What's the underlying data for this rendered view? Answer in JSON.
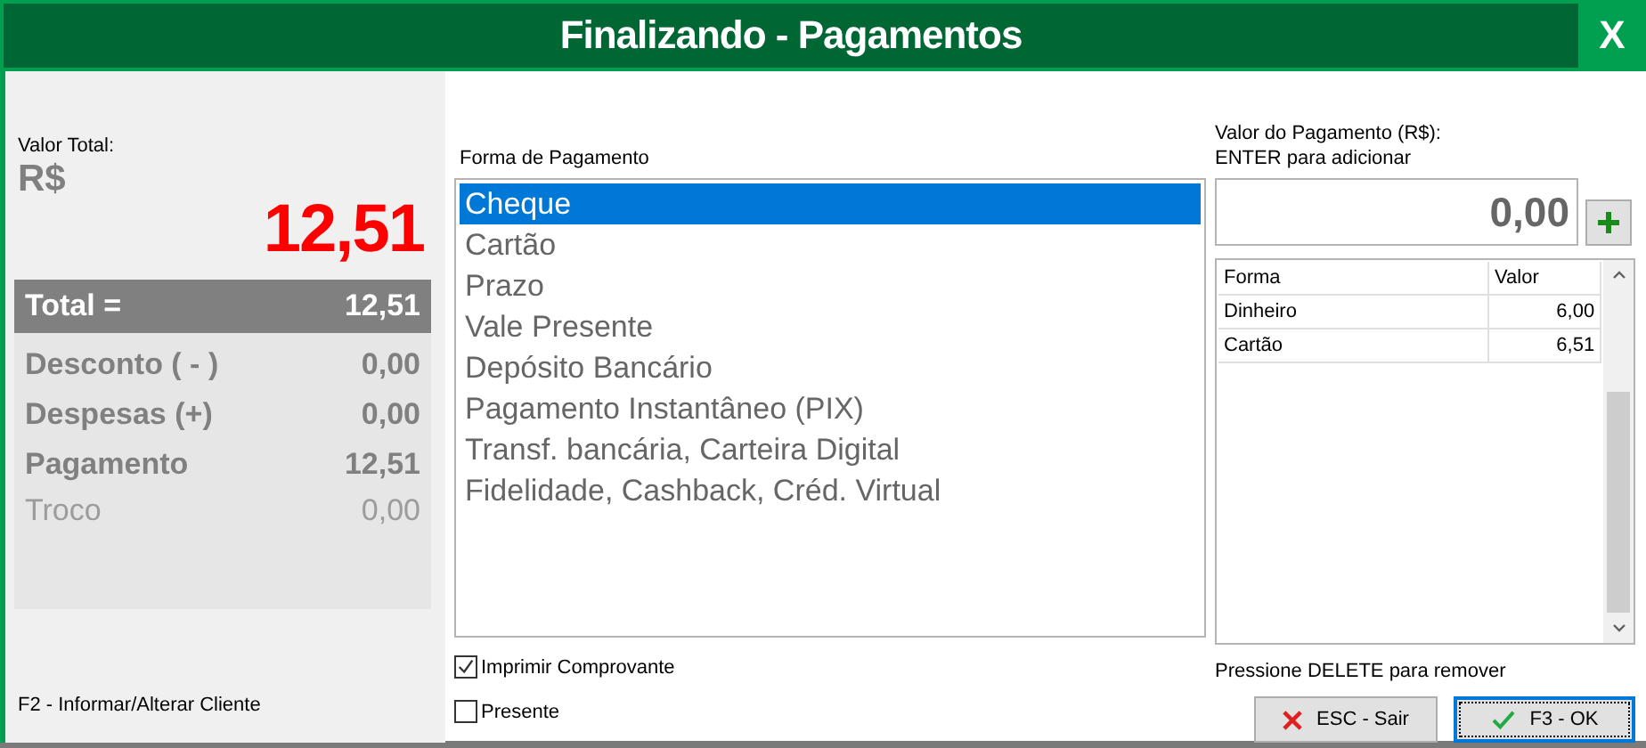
{
  "window": {
    "title": "Finalizando - Pagamentos",
    "close": "X"
  },
  "summary": {
    "label": "Valor Total:",
    "currency": "R$",
    "total": "12,51",
    "header": {
      "label": "Total =",
      "value": "12,51"
    },
    "rows": [
      {
        "label": "Desconto ( - )",
        "value": "0,00",
        "disabled": false
      },
      {
        "label": "Despesas (+)",
        "value": "0,00",
        "disabled": false
      },
      {
        "label": "Pagamento",
        "value": "12,51",
        "disabled": false
      },
      {
        "label": "Troco",
        "value": "0,00",
        "disabled": true
      }
    ],
    "hint": "F2 - Informar/Alterar Cliente"
  },
  "payment_methods": {
    "label": "Forma de Pagamento",
    "items": [
      {
        "label": "Cheque",
        "selected": true
      },
      {
        "label": "Cartão",
        "selected": false
      },
      {
        "label": "Prazo",
        "selected": false
      },
      {
        "label": "Vale Presente",
        "selected": false
      },
      {
        "label": "Depósito Bancário",
        "selected": false
      },
      {
        "label": "Pagamento Instantâneo (PIX)",
        "selected": false
      },
      {
        "label": "Transf. bancária, Carteira Digital",
        "selected": false
      },
      {
        "label": "Fidelidade, Cashback, Créd. Virtual",
        "selected": false
      }
    ]
  },
  "options": [
    {
      "label": "Imprimir Comprovante",
      "checked": true
    },
    {
      "label": "Presente",
      "checked": false
    }
  ],
  "payment_value": {
    "label": "Valor do Pagamento (R$):",
    "hint": "ENTER para adicionar",
    "value": "0,00"
  },
  "payments_table": {
    "columns": [
      "Forma",
      "Valor"
    ],
    "rows": [
      [
        "Dinheiro",
        "6,00"
      ],
      [
        "Cartão",
        "6,51"
      ]
    ]
  },
  "delete_hint": "Pressione DELETE para remover",
  "buttons": [
    {
      "kind": "cancel",
      "label": "ESC - Sair"
    },
    {
      "kind": "ok",
      "label": "F3 - OK"
    }
  ]
}
